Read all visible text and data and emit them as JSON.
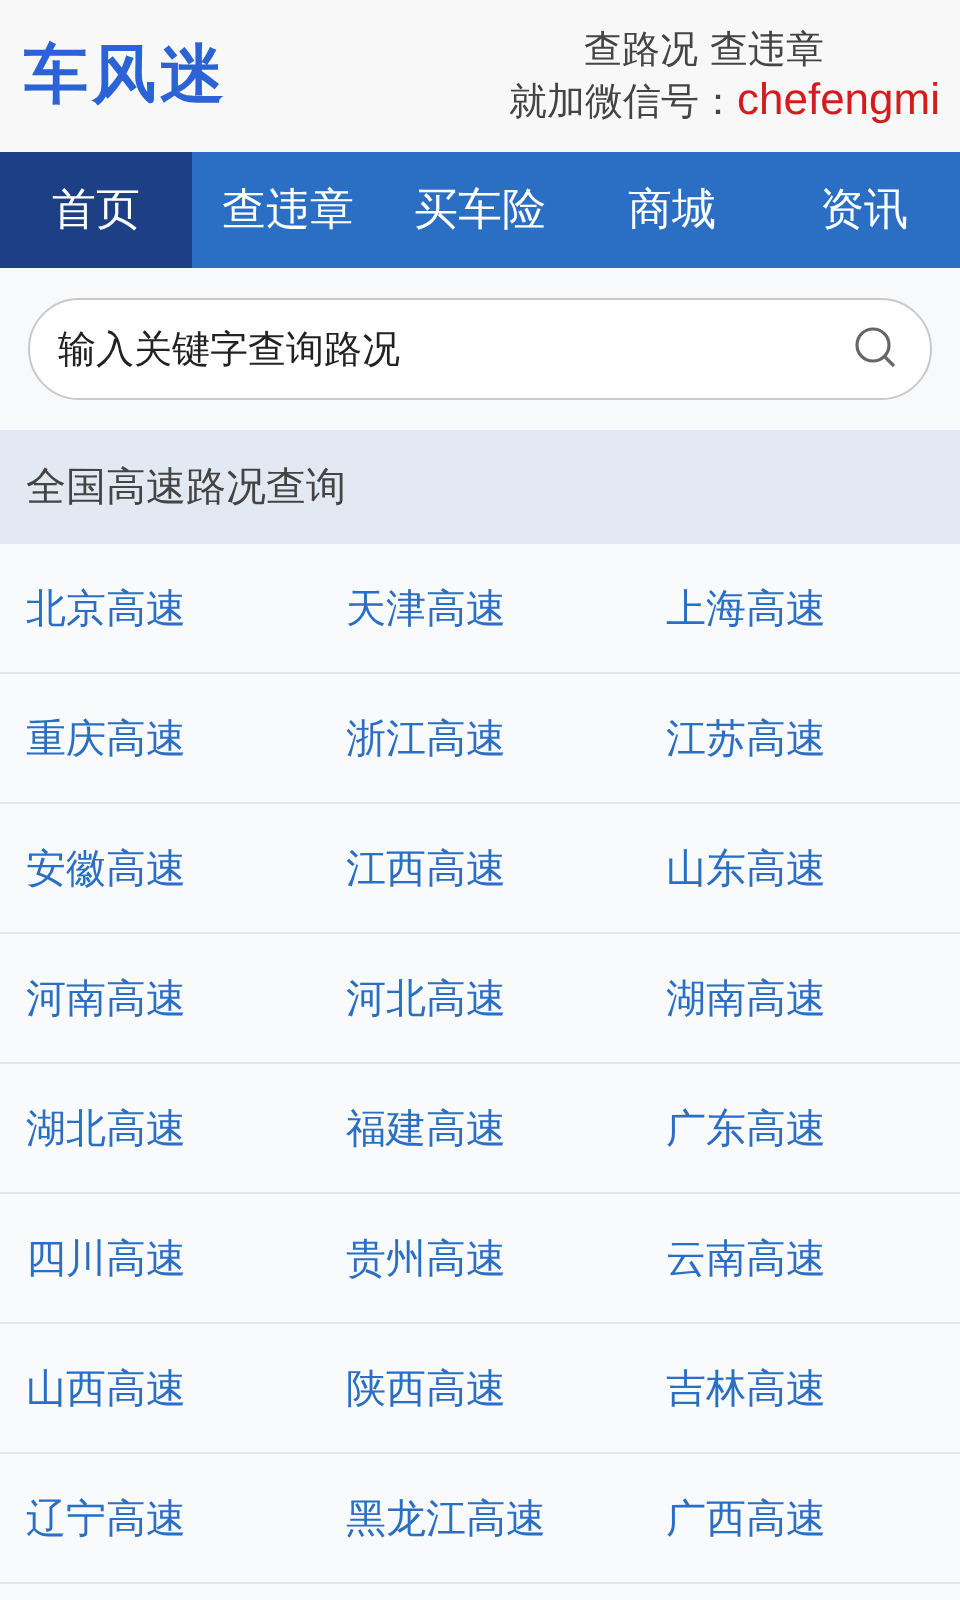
{
  "header": {
    "logo": "车风迷",
    "tagline": "查路况 查违章",
    "wechat_label": "就加微信号：",
    "wechat_id": "chefengmi"
  },
  "nav": [
    {
      "label": "首页",
      "selected": true
    },
    {
      "label": "查违章",
      "selected": false
    },
    {
      "label": "买车险",
      "selected": false
    },
    {
      "label": "商城",
      "selected": false
    },
    {
      "label": "资讯",
      "selected": false
    }
  ],
  "search": {
    "placeholder": "输入关键字查询路况"
  },
  "section": {
    "title": "全国高速路况查询",
    "rows": [
      [
        "北京高速",
        "天津高速",
        "上海高速"
      ],
      [
        "重庆高速",
        "浙江高速",
        "江苏高速"
      ],
      [
        "安徽高速",
        "江西高速",
        "山东高速"
      ],
      [
        "河南高速",
        "河北高速",
        "湖南高速"
      ],
      [
        "湖北高速",
        "福建高速",
        "广东高速"
      ],
      [
        "四川高速",
        "贵州高速",
        "云南高速"
      ],
      [
        "山西高速",
        "陕西高速",
        "吉林高速"
      ],
      [
        "辽宁高速",
        "黑龙江高速",
        "广西高速"
      ]
    ]
  }
}
